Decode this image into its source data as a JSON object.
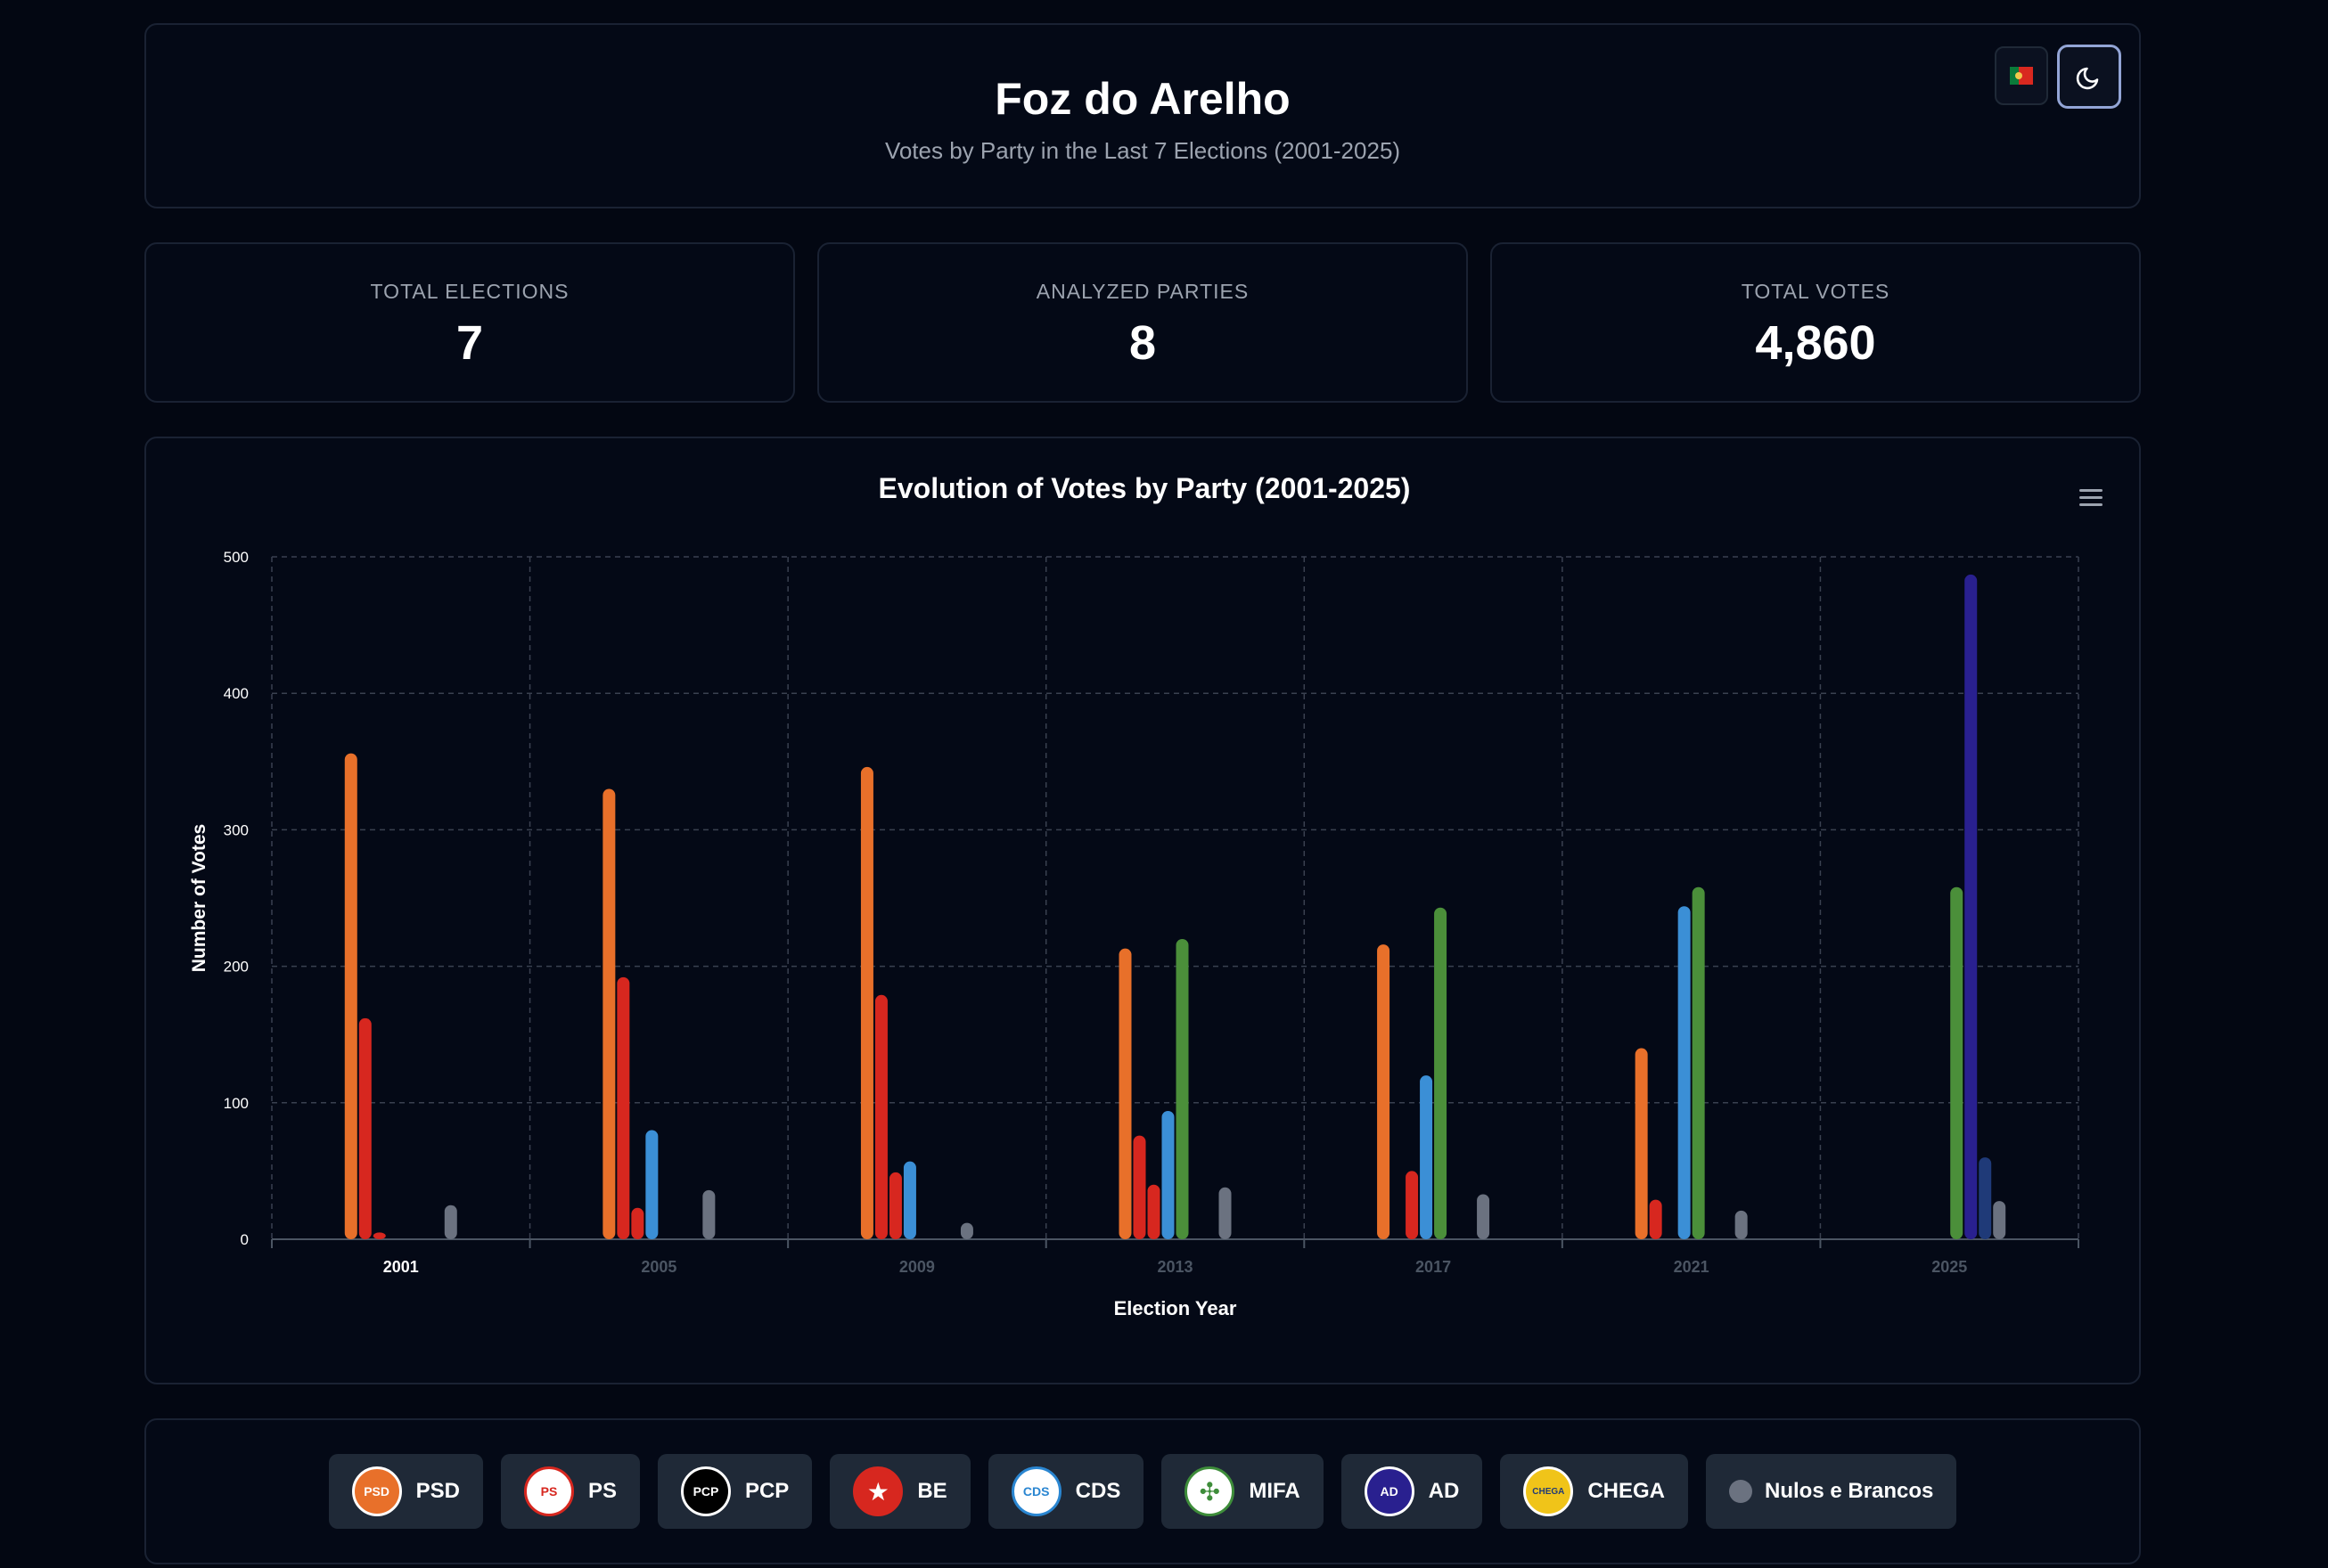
{
  "header": {
    "title": "Foz do Arelho",
    "subtitle": "Votes by Party in the Last 7 Elections (2001-2025)",
    "flag_icon": "portugal-flag-icon",
    "theme_icon": "moon-icon"
  },
  "stats": [
    {
      "label": "TOTAL ELECTIONS",
      "value": "7"
    },
    {
      "label": "ANALYZED PARTIES",
      "value": "8"
    },
    {
      "label": "TOTAL VOTES",
      "value": "4,860"
    }
  ],
  "chart_data": {
    "type": "bar",
    "title": "Evolution of Votes by Party (2001-2025)",
    "xlabel": "Election Year",
    "ylabel": "Number of Votes",
    "ylim": [
      0,
      500
    ],
    "yticks": [
      0,
      100,
      200,
      300,
      400,
      500
    ],
    "grid": true,
    "categories": [
      "2001",
      "2005",
      "2009",
      "2013",
      "2017",
      "2021",
      "2025"
    ],
    "highlighted_category": "2001",
    "series": [
      {
        "name": "PSD",
        "color": "#e8702a",
        "values": [
          356,
          330,
          346,
          213,
          216,
          140,
          null
        ]
      },
      {
        "name": "PS",
        "color": "#d7271f",
        "values": [
          162,
          192,
          179,
          76,
          null,
          29,
          null
        ]
      },
      {
        "name": "PCP",
        "color": "#d7271f",
        "values": [
          5,
          23,
          49,
          40,
          50,
          null,
          null
        ]
      },
      {
        "name": "BE",
        "color": "#3b8fd6",
        "values": [
          null,
          80,
          57,
          94,
          120,
          244,
          null
        ]
      },
      {
        "name": "MIFA",
        "color": "#4b8f3a",
        "values": [
          null,
          null,
          null,
          220,
          243,
          258,
          258
        ]
      },
      {
        "name": "AD",
        "color": "#29208f",
        "values": [
          null,
          null,
          null,
          null,
          null,
          null,
          487
        ]
      },
      {
        "name": "CHEGA",
        "color": "#1f3a78",
        "values": [
          null,
          null,
          null,
          null,
          null,
          null,
          60
        ]
      },
      {
        "name": "Nulos e Brancos",
        "color": "#6b7280",
        "values": [
          25,
          36,
          12,
          38,
          33,
          21,
          28
        ]
      }
    ]
  },
  "legend": [
    {
      "label": "PSD",
      "icon": "psd-logo-icon",
      "logo_text": "PSD",
      "bg": "#e8702a",
      "fg": "#ffffff",
      "ring": "#ffffff"
    },
    {
      "label": "PS",
      "icon": "ps-logo-icon",
      "logo_text": "PS",
      "bg": "#ffffff",
      "fg": "#d7271f",
      "ring": "#d7271f"
    },
    {
      "label": "PCP",
      "icon": "pcp-logo-icon",
      "logo_text": "PCP",
      "bg": "#000000",
      "fg": "#ffffff",
      "ring": "#ffffff"
    },
    {
      "label": "BE",
      "icon": "be-logo-icon",
      "logo_text": "★",
      "bg": "#d7271f",
      "fg": "#ffffff",
      "ring": "#d7271f"
    },
    {
      "label": "CDS",
      "icon": "cds-logo-icon",
      "logo_text": "CDS",
      "bg": "#ffffff",
      "fg": "#2a86d1",
      "ring": "#2a86d1"
    },
    {
      "label": "MIFA",
      "icon": "mifa-clover-icon",
      "logo_text": "✣",
      "bg": "#ffffff",
      "fg": "#3e8d3a",
      "ring": "#3e8d3a"
    },
    {
      "label": "AD",
      "icon": "ad-logo-icon",
      "logo_text": "AD",
      "bg": "#29208f",
      "fg": "#ffffff",
      "ring": "#ffffff"
    },
    {
      "label": "CHEGA",
      "icon": "chega-logo-icon",
      "logo_text": "CHEGA",
      "bg": "#f0c419",
      "fg": "#1f3a78",
      "ring": "#ffffff"
    },
    {
      "label": "Nulos e Brancos",
      "icon": "nulos-dot-icon",
      "logo_text": "",
      "bg": "#6b7280",
      "fg": "#6b7280",
      "ring": ""
    }
  ]
}
